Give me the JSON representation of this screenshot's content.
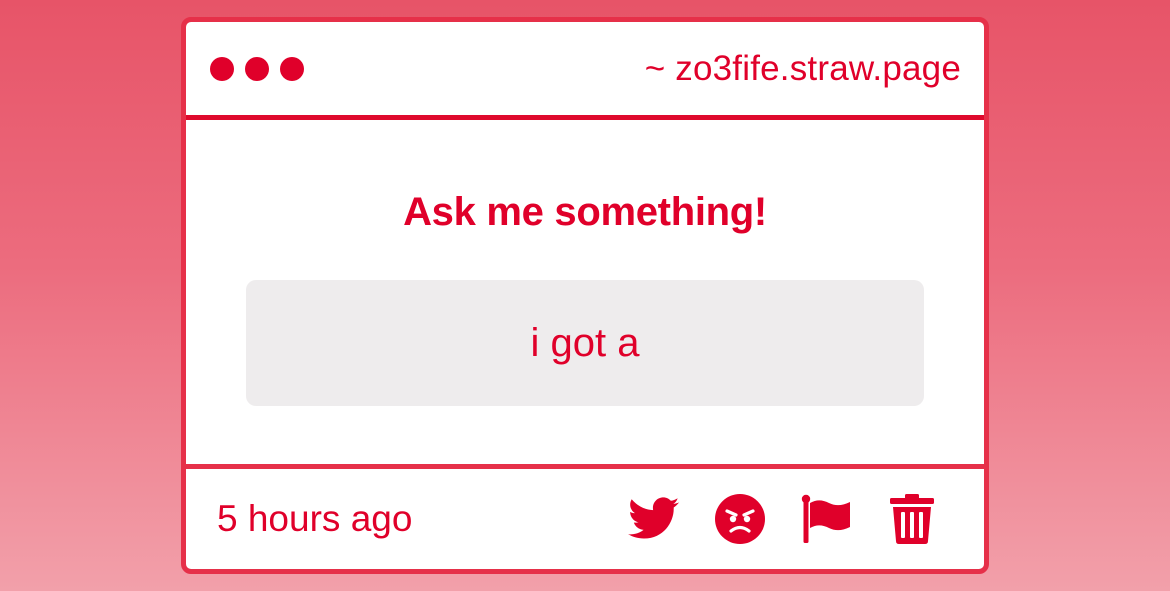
{
  "window": {
    "url": "~ zo3fife.straw.page",
    "dots": [
      "dot",
      "dot",
      "dot"
    ]
  },
  "question": {
    "heading": "Ask me something!",
    "answer": "i got a"
  },
  "footer": {
    "timestamp": "5 hours ago",
    "actions": [
      {
        "name": "twitter-share-button",
        "icon": "twitter-icon"
      },
      {
        "name": "angry-reaction-button",
        "icon": "angry-face-icon"
      },
      {
        "name": "report-button",
        "icon": "flag-icon"
      },
      {
        "name": "delete-button",
        "icon": "trash-icon"
      }
    ]
  },
  "colors": {
    "accent": "#e0002a",
    "border": "#e63049",
    "answer_bg": "#eeeced",
    "card_bg": "#ffffff"
  }
}
